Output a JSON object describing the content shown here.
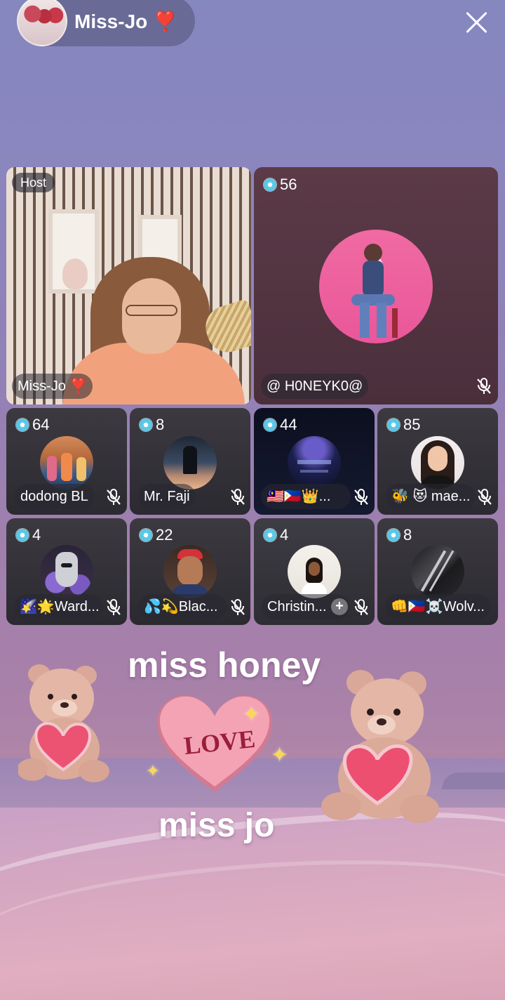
{
  "header": {
    "host_name": "Miss-Jo ❣️"
  },
  "host_tile": {
    "badge": "Host",
    "name": "Miss-Jo ❣️"
  },
  "featured_tile": {
    "count": "56",
    "name": "@ H0NEYK0@"
  },
  "seats": [
    {
      "count": "64",
      "name": "dodong BL"
    },
    {
      "count": "8",
      "name": "Mr. Faji"
    },
    {
      "count": "44",
      "name": "🇲🇾🇵🇭👑..."
    },
    {
      "count": "85",
      "name": "🐝 😻 mae..."
    },
    {
      "count": "4",
      "name": "🌠🌟Ward..."
    },
    {
      "count": "22",
      "name": "💦💫Blac..."
    },
    {
      "count": "4",
      "name": "Christin..."
    },
    {
      "count": "8",
      "name": "👊🇵🇭☠️Wolv..."
    }
  ],
  "sticker": {
    "line1": "miss honey",
    "heart_word": "LOVE",
    "line2": "miss jo"
  },
  "colors": {
    "heart_fill": "#f4a3b5",
    "heart_text": "#9a1e3a",
    "diamond": "#5ac8e8"
  }
}
